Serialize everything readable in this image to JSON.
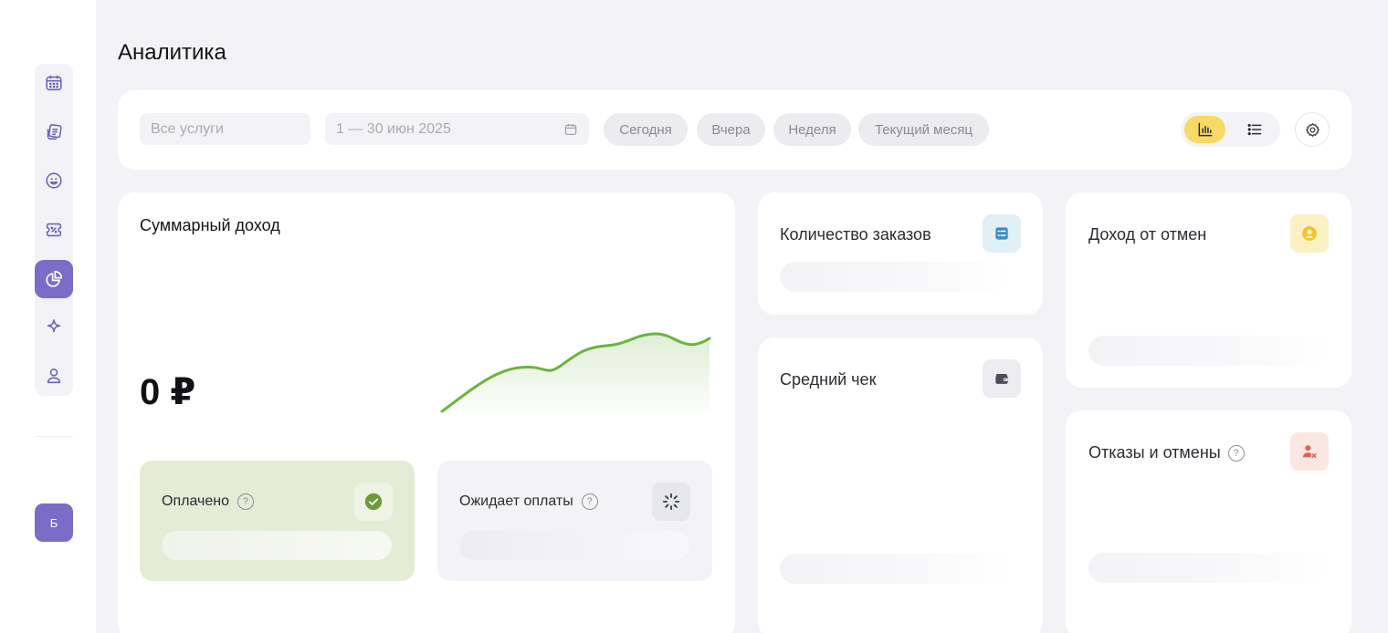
{
  "page": {
    "title": "Аналитика"
  },
  "sidebar": {
    "items": [
      {
        "icon": "calendar-icon"
      },
      {
        "icon": "documents-icon"
      },
      {
        "icon": "smile-icon"
      },
      {
        "icon": "discount-ticket-icon"
      },
      {
        "icon": "pie-chart-icon",
        "active": true
      },
      {
        "icon": "sparkle-icon"
      },
      {
        "icon": "user-icon"
      }
    ],
    "avatar_letter": "Б"
  },
  "filters": {
    "services_placeholder": "Все услуги",
    "date_range": "1 — 30 июн 2025",
    "chips": [
      "Сегодня",
      "Вчера",
      "Неделя",
      "Текущий месяц"
    ],
    "view_mode": "chart"
  },
  "revenue": {
    "title": "Суммарный доход",
    "value": "0 ₽",
    "paid_label": "Оплачено",
    "pending_label": "Ожидает оплаты"
  },
  "orders": {
    "title": "Количество заказов"
  },
  "avg_check": {
    "title": "Средний чек"
  },
  "cancel_income": {
    "title": "Доход от отмен"
  },
  "refusals": {
    "title": "Отказы и отмены"
  },
  "colors": {
    "accent": "#7b6cc8",
    "toggle_active": "#f7da63",
    "chart_line": "#6cb33f",
    "paid_bg": "#e3ecd5",
    "refusals_icon": "#e0604f",
    "orders_icon": "#3f8fbd"
  }
}
